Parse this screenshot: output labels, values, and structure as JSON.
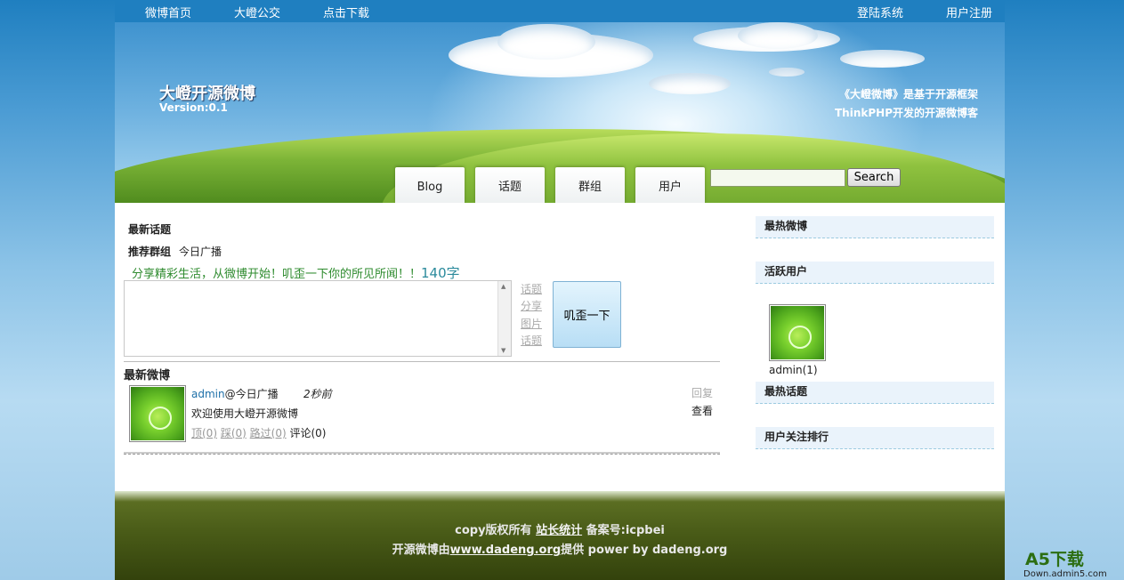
{
  "topnav": {
    "left": [
      "微博首页",
      "大嶝公交",
      "点击下载"
    ],
    "right": [
      "登陆系统",
      "用户注册"
    ]
  },
  "header": {
    "title": "大嶝开源微博",
    "version": "Version:0.1",
    "slogan_line1": "《大嶝微博》是基于开源框架",
    "slogan_line2": "ThinkPHP开发的开源微博客"
  },
  "tabs": [
    "Blog",
    "话题",
    "群组",
    "用户"
  ],
  "search": {
    "button": "Search",
    "value": ""
  },
  "main": {
    "latest_topics": "最新话题",
    "recommend_group_label": "推荐群组",
    "recommend_group_value": "今日广播",
    "prompt": "分享精彩生活，从微博开始！叽歪一下你的所见所闻！！",
    "char_count": "140字",
    "side_links": [
      "话题",
      "分享",
      "图片",
      "话题"
    ],
    "post_button": "叽歪一下",
    "latest_weibo": "最新微博"
  },
  "post": {
    "user": "admin",
    "at_group": "@今日广播",
    "time": "2秒前",
    "content": "欢迎使用大嶝开源微博",
    "actions": [
      "顶(0)",
      "踩(0)",
      "路过(0)"
    ],
    "comments": "评论(0)",
    "reply": "回复",
    "view": "查看"
  },
  "sidebar": {
    "hot_weibo": "最热微博",
    "active_users": "活跃用户",
    "active_user_name": "admin(1)",
    "hot_topics": "最热话题",
    "follow_rank": "用户关注排行"
  },
  "footer": {
    "line1_prefix": "copy版权所有",
    "line1_link": "站长统计",
    "line1_suffix": "备案号:icpbei",
    "line2_prefix": "开源微博由",
    "line2_link": "www.dadeng.org",
    "line2_suffix": "提供 power by dadeng.org"
  },
  "watermark": {
    "logo": "A5下载",
    "url": "Down.admin5.com"
  }
}
